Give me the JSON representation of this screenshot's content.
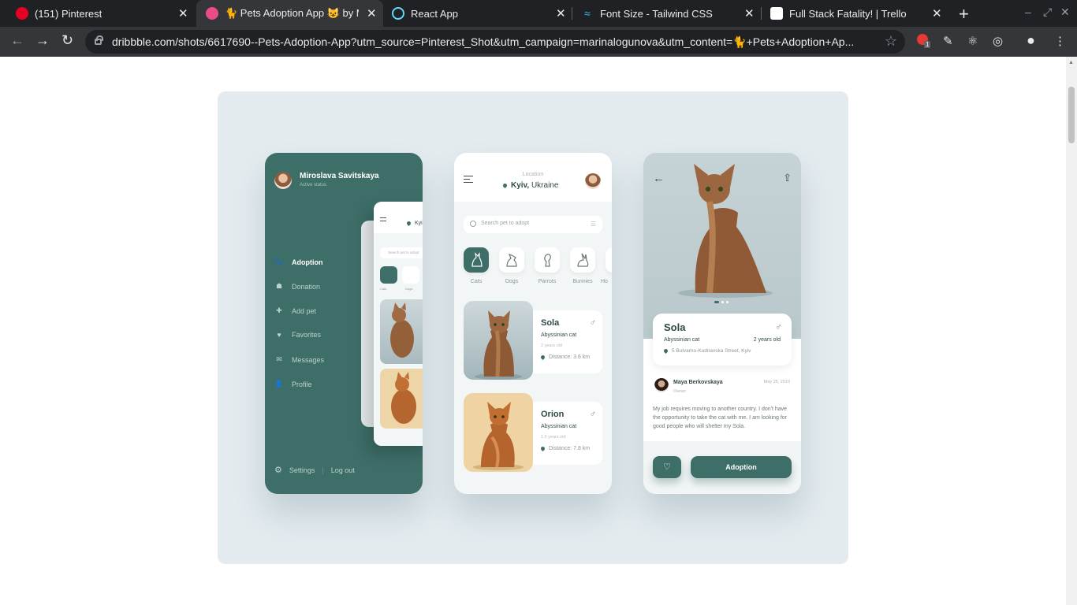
{
  "browser": {
    "tabs": [
      {
        "title": "(151) Pinterest",
        "color": "#e60023"
      },
      {
        "title": "🐈 Pets Adoption App 😺 by M",
        "color": "#ea4c89"
      },
      {
        "title": "React App",
        "color": "#61dafb"
      },
      {
        "title": "Font Size - Tailwind CSS",
        "color": "#38bdf8"
      },
      {
        "title": "Full Stack Fatality! | Trello",
        "color": "#ffffff"
      }
    ],
    "url": "dribbble.com/shots/6617690--Pets-Adoption-App?utm_source=Pinterest_Shot&utm_campaign=marinalogunova&utm_content=🐈+Pets+Adoption+Ap...",
    "extension_badge": "1"
  },
  "menu_phone": {
    "user_name": "Miroslava Savitskaya",
    "user_status": "Active status",
    "items": [
      {
        "label": "Adoption",
        "icon": "paw-icon",
        "glyph": "🐾"
      },
      {
        "label": "Donation",
        "icon": "donation-icon",
        "glyph": "☗"
      },
      {
        "label": "Add pet",
        "icon": "plus-icon",
        "glyph": "✚"
      },
      {
        "label": "Favorites",
        "icon": "heart-icon",
        "glyph": "♥"
      },
      {
        "label": "Messages",
        "icon": "mail-icon",
        "glyph": "✉"
      },
      {
        "label": "Profile",
        "icon": "user-icon",
        "glyph": "👤"
      }
    ],
    "settings": "Settings",
    "logout": "Log out"
  },
  "list_phone": {
    "location_label": "Location",
    "location_city": "Kyiv,",
    "location_country": " Ukraine",
    "search_placeholder": "Search pet to adopt",
    "categories": [
      "Cats",
      "Dogs",
      "Parrots",
      "Bunnies",
      "Ho"
    ],
    "pets": [
      {
        "name": "Sola",
        "breed": "Abyssinian cat",
        "age": "2 years old",
        "distance": "Distance: 3.6 km"
      },
      {
        "name": "Orion",
        "breed": "Abyssinian cat",
        "age": "1.5 years old",
        "distance": "Distance: 7.8 km"
      }
    ]
  },
  "detail_phone": {
    "name": "Sola",
    "breed": "Abyssinian cat",
    "age": "2 years old",
    "address": "5 Bulvarno-Kudriavska Street, Kyiv",
    "owner_name": "Maya Berkovskaya",
    "owner_role": "Owner",
    "date": "May 25, 2019",
    "description": "My job requires moving to another country. I don't have the opportunity to take the cat with me. I am looking for good people who will shelter my Sola.",
    "adopt_label": "Adoption"
  },
  "colors": {
    "brand": "#3e6e68",
    "tabbar": "#202124",
    "toolbar": "#35363a"
  }
}
